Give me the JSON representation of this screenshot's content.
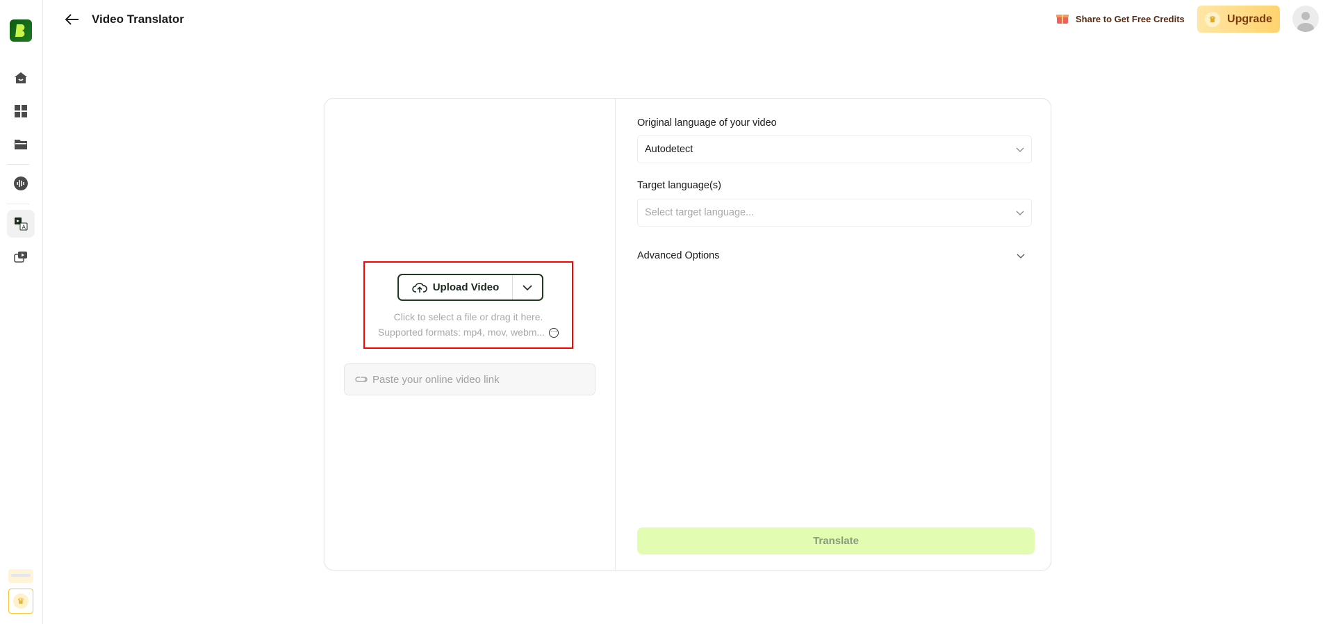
{
  "header": {
    "title": "Video Translator",
    "share_label": "Share to Get Free Credits",
    "upgrade_label": "Upgrade"
  },
  "sidebar": {
    "items": [
      "home",
      "templates",
      "files",
      "audio",
      "video-translator",
      "video-subtitles"
    ],
    "active": "video-translator"
  },
  "upload": {
    "button_label": "Upload Video",
    "hint_line1": "Click to select a file or drag it here.",
    "hint_line2": "Supported formats: mp4, mov, webm...",
    "paste_placeholder": "Paste your online video link"
  },
  "settings": {
    "original_label": "Original language of your video",
    "original_value": "Autodetect",
    "target_label": "Target language(s)",
    "target_placeholder": "Select target language...",
    "advanced_label": "Advanced Options",
    "translate_label": "Translate"
  },
  "colors": {
    "accent": "#1e3b22",
    "translate_bg": "#e2fdb2",
    "upgrade": "#ffd36e",
    "highlight": "#ff0000"
  }
}
